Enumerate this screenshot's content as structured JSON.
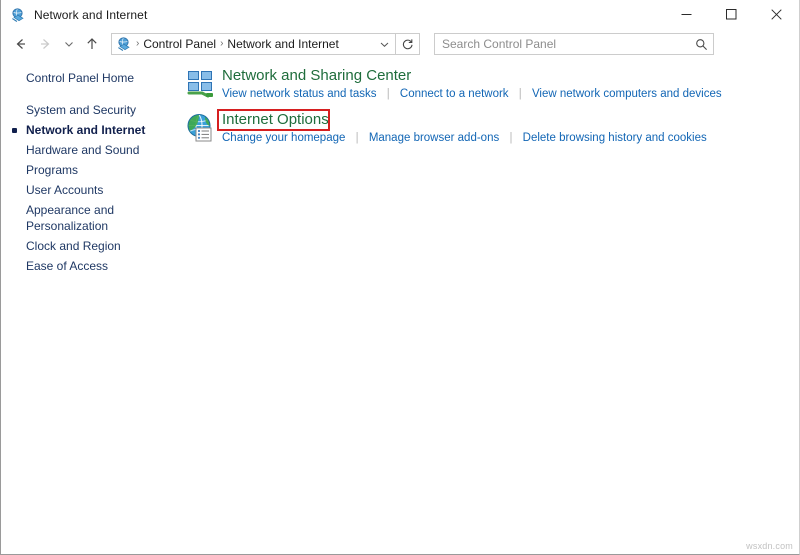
{
  "window": {
    "title": "Network and Internet",
    "title_icon": "network-globe-icon",
    "controls": {
      "minimize": "minimize-icon",
      "maximize": "maximize-icon",
      "close": "close-icon"
    }
  },
  "toolbar": {
    "back": "back-arrow-icon",
    "forward": "forward-arrow-icon",
    "recent": "chevron-down-icon",
    "up": "up-arrow-icon",
    "breadcrumb": {
      "icon": "network-globe-icon",
      "items": [
        "Control Panel",
        "Network and Internet"
      ],
      "separator": "›",
      "dropdown": "chevron-down-icon"
    },
    "refresh": "refresh-icon"
  },
  "search": {
    "placeholder": "Search Control Panel",
    "value": "",
    "icon": "search-icon"
  },
  "sidebar": {
    "items": [
      {
        "label": "Control Panel Home",
        "selected": false
      },
      {
        "label": "System and Security",
        "selected": false
      },
      {
        "label": "Network and Internet",
        "selected": true
      },
      {
        "label": "Hardware and Sound",
        "selected": false
      },
      {
        "label": "Programs",
        "selected": false
      },
      {
        "label": "User Accounts",
        "selected": false
      },
      {
        "label": "Appearance and\nPersonalization",
        "selected": false
      },
      {
        "label": "Clock and Region",
        "selected": false
      },
      {
        "label": "Ease of Access",
        "selected": false
      }
    ]
  },
  "main": {
    "categories": [
      {
        "title": "Network and Sharing Center",
        "icon": "network-sharing-center-icon",
        "highlighted": false,
        "links": [
          "View network status and tasks",
          "Connect to a network",
          "View network computers and devices"
        ]
      },
      {
        "title": "Internet Options",
        "icon": "internet-options-globe-icon",
        "highlighted": true,
        "links": [
          "Change your homepage",
          "Manage browser add-ons",
          "Delete browsing history and cookies"
        ]
      }
    ]
  },
  "annotation": {
    "color": "#d61f20",
    "target": "Internet Options"
  },
  "watermark": {
    "text": "wsxdn.com"
  },
  "colors": {
    "category_title": "#1f6d3c",
    "link": "#1266b5",
    "sidebar_link": "#1f3864",
    "annotation_red": "#d61f20"
  }
}
